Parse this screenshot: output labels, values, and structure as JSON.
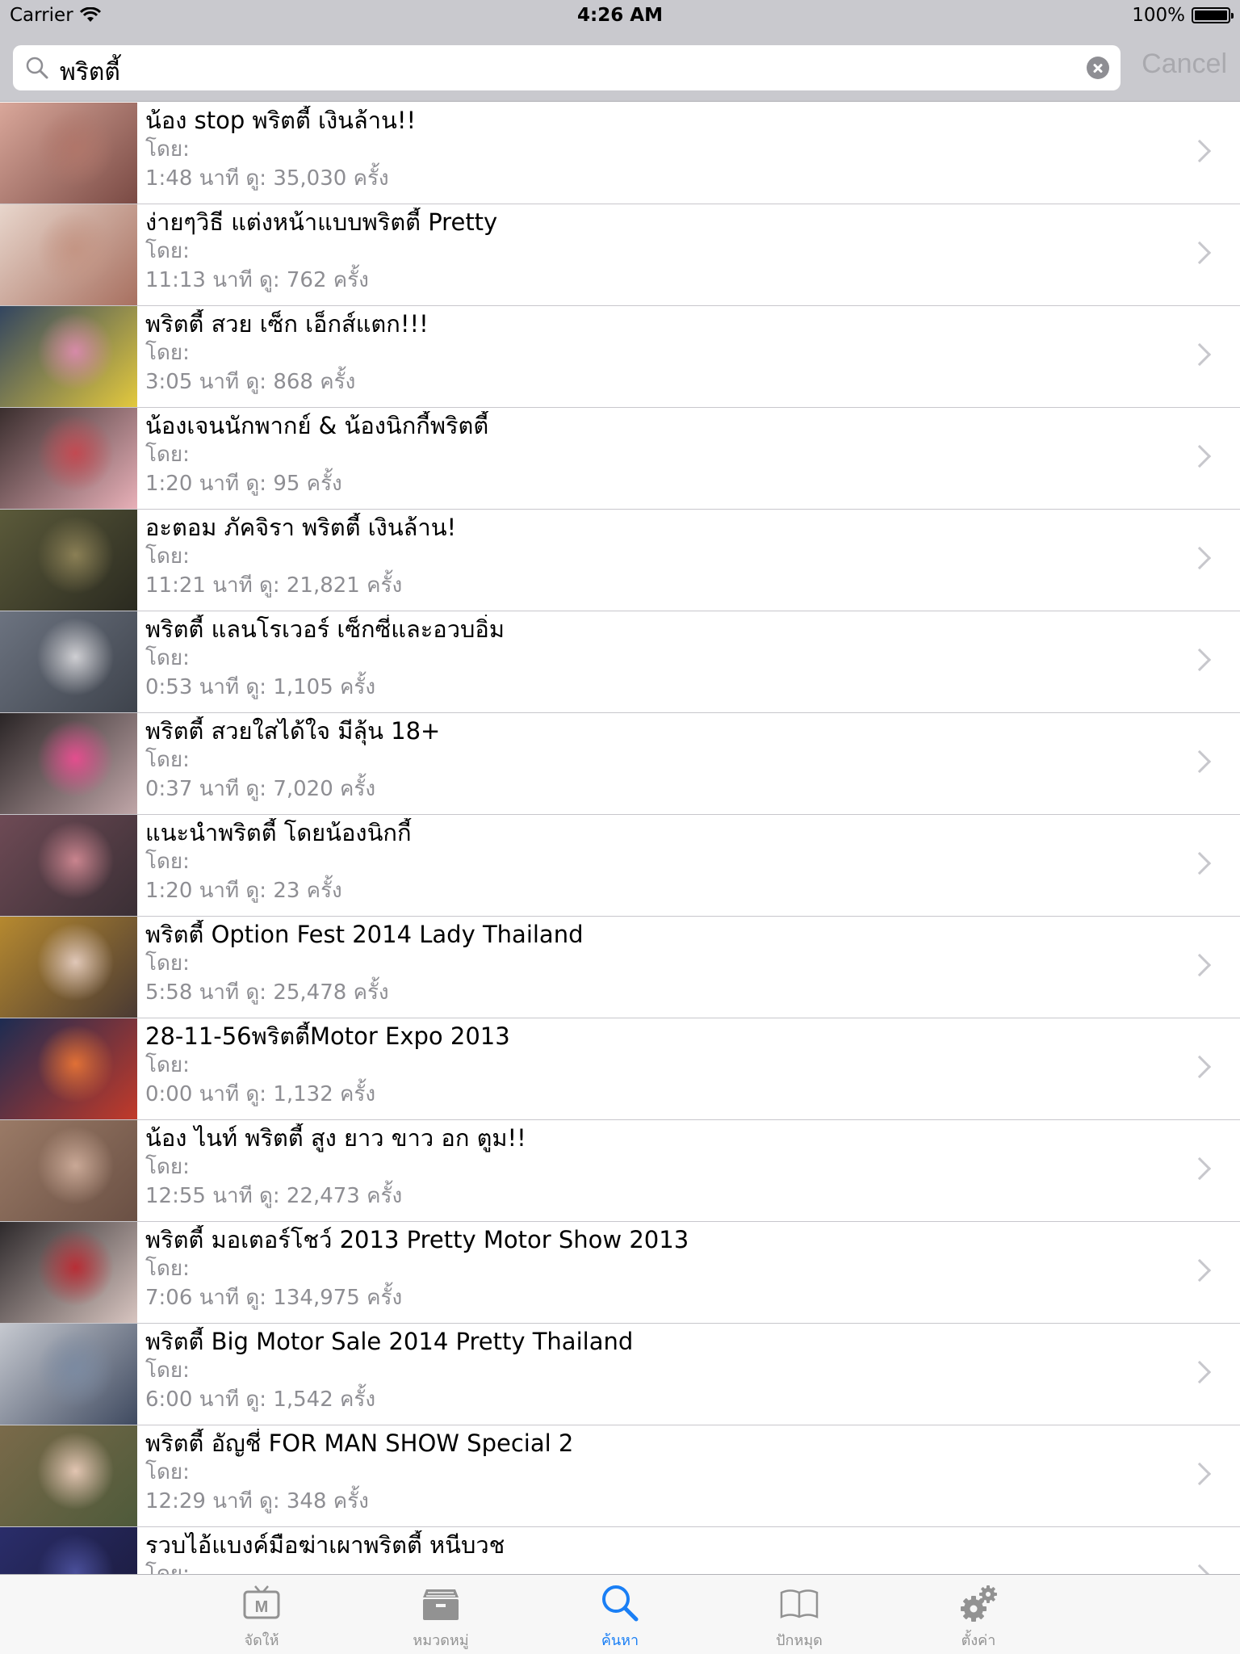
{
  "status_bar": {
    "carrier": "Carrier",
    "time": "4:26 AM",
    "battery": "100%"
  },
  "search": {
    "query": "พริตตี้",
    "cancel_label": "Cancel"
  },
  "results": [
    {
      "title": "น้อง stop พริตตี้ เงินล้าน!!",
      "by": "โดย:",
      "meta": "1:48 นาที  ดู: 35,030 ครั้ง",
      "colors": [
        "#d9a79a",
        "#b0766a",
        "#7a4a44"
      ]
    },
    {
      "title": "ง่ายๆวิธี แต่งหน้าแบบพริตตี้ Pretty",
      "by": "โดย:",
      "meta": "11:13 นาที  ดู: 762 ครั้ง",
      "colors": [
        "#e8d6cc",
        "#c49584",
        "#a87060"
      ]
    },
    {
      "title": "พริตตี้ สวย เซ็ก เอ็กส์แตก!!!",
      "by": "โดย:",
      "meta": "3:05 นาที  ดู: 868 ครั้ง",
      "colors": [
        "#324560",
        "#d68aa8",
        "#e3c93d"
      ]
    },
    {
      "title": "น้องเจนนักพากย์ & น้องนิกกี้พริตตี้",
      "by": "โดย:",
      "meta": "1:20 นาที  ดู: 95 ครั้ง",
      "colors": [
        "#3a2e2e",
        "#c24a52",
        "#e8b0b8"
      ]
    },
    {
      "title": "อะตอม ภัคจิรา พริตตี้ เงินล้าน!",
      "by": "โดย:",
      "meta": "11:21 นาที  ดู: 21,821 ครั้ง",
      "colors": [
        "#5b5a3a",
        "#8a7f55",
        "#2a2a20"
      ]
    },
    {
      "title": "พริตตี้ แลนโรเวอร์ เซ็กซี่และอวบอิ่ม",
      "by": "โดย:",
      "meta": "0:53 นาที  ดู: 1,105 ครั้ง",
      "colors": [
        "#6c7380",
        "#cfcfd3",
        "#3e434c"
      ]
    },
    {
      "title": "พริตตี้ สวยใสได้ใจ มีลุ้น 18+",
      "by": "โดย:",
      "meta": "0:37 นาที  ดู: 7,020 ครั้ง",
      "colors": [
        "#2a2526",
        "#e34e8e",
        "#c0a6a8"
      ]
    },
    {
      "title": "แนะนำพริตตี้ โดยน้องนิกกี้",
      "by": "โดย:",
      "meta": "1:20 นาที  ดู: 23 ครั้ง",
      "colors": [
        "#6e4a55",
        "#c9848e",
        "#3a2f35"
      ]
    },
    {
      "title": "พริตตี้ Option Fest 2014 Lady Thailand",
      "by": "โดย:",
      "meta": "5:58 นาที  ดู: 25,478 ครั้ง",
      "colors": [
        "#b6892f",
        "#e0c7b8",
        "#4a3a33"
      ]
    },
    {
      "title": "28-11-56พริตตี้Motor Expo 2013",
      "by": "โดย:",
      "meta": "0:00 นาที  ดู: 1,132 ครั้ง",
      "colors": [
        "#1d2c52",
        "#e07036",
        "#c23a2a"
      ]
    },
    {
      "title": "น้อง ไนท์ พริตตี้ สูง ยาว ขาว อก ตูม!!",
      "by": "โดย:",
      "meta": "12:55 นาที  ดู: 22,473 ครั้ง",
      "colors": [
        "#9a7a66",
        "#c9a896",
        "#6a5044"
      ]
    },
    {
      "title": "พริตตี้ มอเตอร์โชว์ 2013 Pretty Motor Show 2013",
      "by": "โดย:",
      "meta": "7:06 นาที  ดู: 134,975 ครั้ง",
      "colors": [
        "#2e2a2c",
        "#b82e36",
        "#d8c5c0"
      ]
    },
    {
      "title": "พริตตี้ Big Motor Sale 2014 Pretty Thailand",
      "by": "โดย:",
      "meta": "6:00 นาที  ดู: 1,542 ครั้ง",
      "colors": [
        "#c6c9d0",
        "#7b8aa1",
        "#3f4a60"
      ]
    },
    {
      "title": "พริตตี้ อัญชี่ FOR MAN SHOW Special 2",
      "by": "โดย:",
      "meta": "12:29 นาที  ดู: 348 ครั้ง",
      "colors": [
        "#7a6a4a",
        "#e2c5b2",
        "#4e5a3a"
      ]
    },
    {
      "title": "รวบไอ้แบงค์มือฆ่าเผาพริตตี้ หนีบวช",
      "by": "โดย:",
      "meta": "",
      "colors": [
        "#2a2d6a",
        "#4a4f9a",
        "#1a1a3a"
      ]
    }
  ],
  "tabs": [
    {
      "label": "จัดให้",
      "icon": "tv-icon",
      "active": false
    },
    {
      "label": "หมวดหมู่",
      "icon": "categories-icon",
      "active": false
    },
    {
      "label": "ค้นหา",
      "icon": "search-icon",
      "active": true
    },
    {
      "label": "ปักหมุด",
      "icon": "bookmark-icon",
      "active": false
    },
    {
      "label": "ตั้งค่า",
      "icon": "settings-icon",
      "active": false
    }
  ],
  "colors": {
    "accent": "#1a7ff5",
    "inactive_tab": "#929292",
    "secondary_text": "#8e8e93"
  }
}
